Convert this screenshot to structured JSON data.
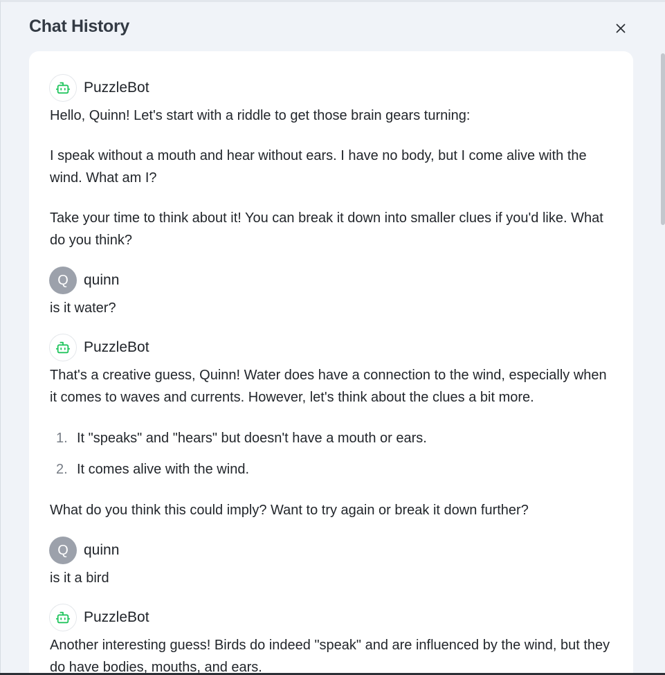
{
  "header": {
    "title": "Chat History",
    "close_label": "×"
  },
  "messages": [
    {
      "sender": "PuzzleBot",
      "role": "bot",
      "avatar_icon": "robot-icon",
      "paragraphs": [
        "Hello, Quinn! Let's start with a riddle to get those brain gears turning:",
        "I speak without a mouth and hear without ears. I have no body, but I come alive with the wind. What am I?",
        "Take your time to think about it! You can break it down into smaller clues if you'd like. What do you think?"
      ]
    },
    {
      "sender": "quinn",
      "role": "user",
      "avatar_letter": "Q",
      "paragraphs": [
        "is it water?"
      ]
    },
    {
      "sender": "PuzzleBot",
      "role": "bot",
      "avatar_icon": "robot-icon",
      "paragraphs": [
        "That's a creative guess, Quinn! Water does have a connection to the wind, especially when it comes to waves and currents. However, let's think about the clues a bit more.",
        "What do you think this could imply? Want to try again or break it down further?"
      ],
      "list": [
        {
          "num": "1.",
          "text": "It \"speaks\" and \"hears\" but doesn't have a mouth or ears."
        },
        {
          "num": "2.",
          "text": "It comes alive with the wind."
        }
      ]
    },
    {
      "sender": "quinn",
      "role": "user",
      "avatar_letter": "Q",
      "paragraphs": [
        "is it a bird"
      ]
    },
    {
      "sender": "PuzzleBot",
      "role": "bot",
      "avatar_icon": "robot-icon",
      "paragraphs": [
        "Another interesting guess! Birds do indeed \"speak\" and are influenced by the wind, but they do have bodies, mouths, and ears."
      ]
    }
  ],
  "colors": {
    "panel_background": "#f0f3f8",
    "card_background": "#ffffff",
    "bot_icon": "#22c55e",
    "user_avatar": "#9ca1ab"
  }
}
